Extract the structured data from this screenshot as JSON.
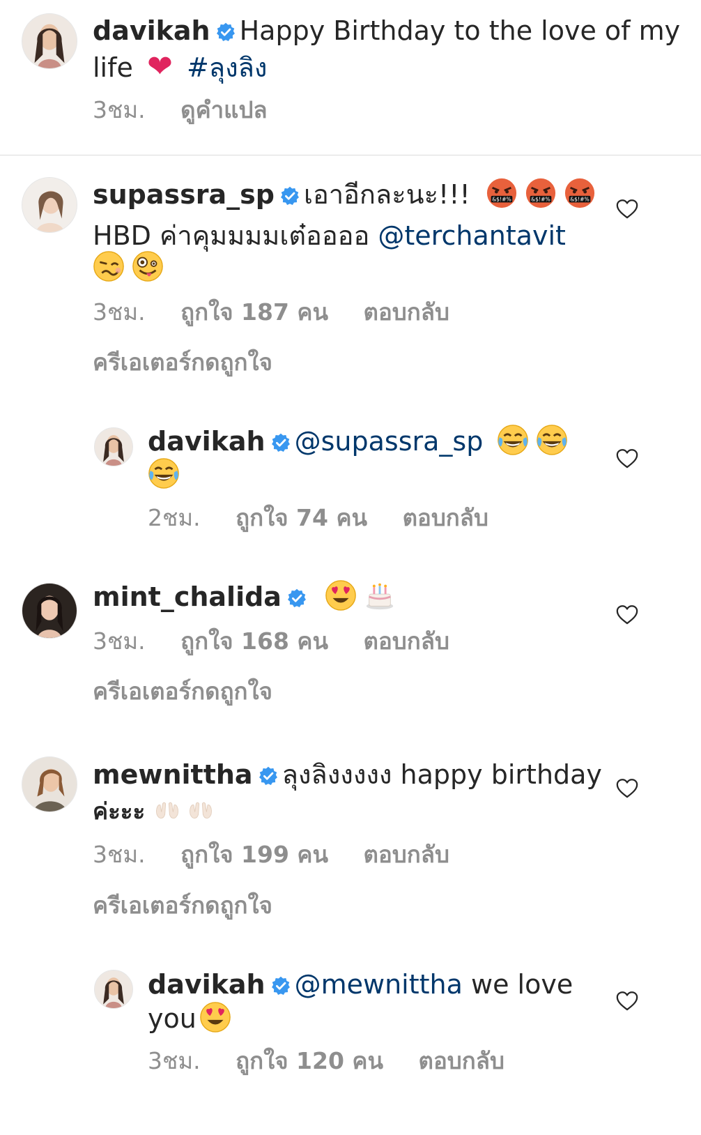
{
  "caption": {
    "username": "davikah",
    "text": "Happy Birthday to the love of my",
    "text2": "life",
    "heart_emoji": "❤",
    "hashtag": "#ลุงลิง",
    "time": "3ชม.",
    "translate": "ดูคำแปล"
  },
  "comments": [
    {
      "username": "supassra_sp",
      "text": "เอาอีกละนะ!!!",
      "text2": "HBD ค่าคุมมมมเต๋ออออ",
      "mention": "@terchantavit",
      "time": "3ชม.",
      "likes": "ถูกใจ 187 คน",
      "reply": "ตอบกลับ",
      "creator_liked": "ครีเอเตอร์กดถูกใจ"
    },
    {
      "username": "davikah",
      "mention": "@supassra_sp",
      "time": "2ชม.",
      "likes": "ถูกใจ 74 คน",
      "reply": "ตอบกลับ"
    },
    {
      "username": "mint_chalida",
      "time": "3ชม.",
      "likes": "ถูกใจ 168 คน",
      "reply": "ตอบกลับ",
      "creator_liked": "ครีเอเตอร์กดถูกใจ"
    },
    {
      "username": "mewnittha",
      "text": "ลุงลิงงงงง happy birthday",
      "text2": "ค่ะะะ",
      "time": "3ชม.",
      "likes": "ถูกใจ 199 คน",
      "reply": "ตอบกลับ",
      "creator_liked": "ครีเอเตอร์กดถูกใจ"
    },
    {
      "username": "davikah",
      "mention": "@mewnittha",
      "text": "we love",
      "text2": "you",
      "time": "3ชม.",
      "likes": "ถูกใจ 120 คน",
      "reply": "ตอบกลับ"
    }
  ],
  "colors": {
    "link": "#00376b",
    "verified": "#3897f0",
    "muted": "#8e8e8e",
    "heart_emoji": "#e0245e"
  }
}
